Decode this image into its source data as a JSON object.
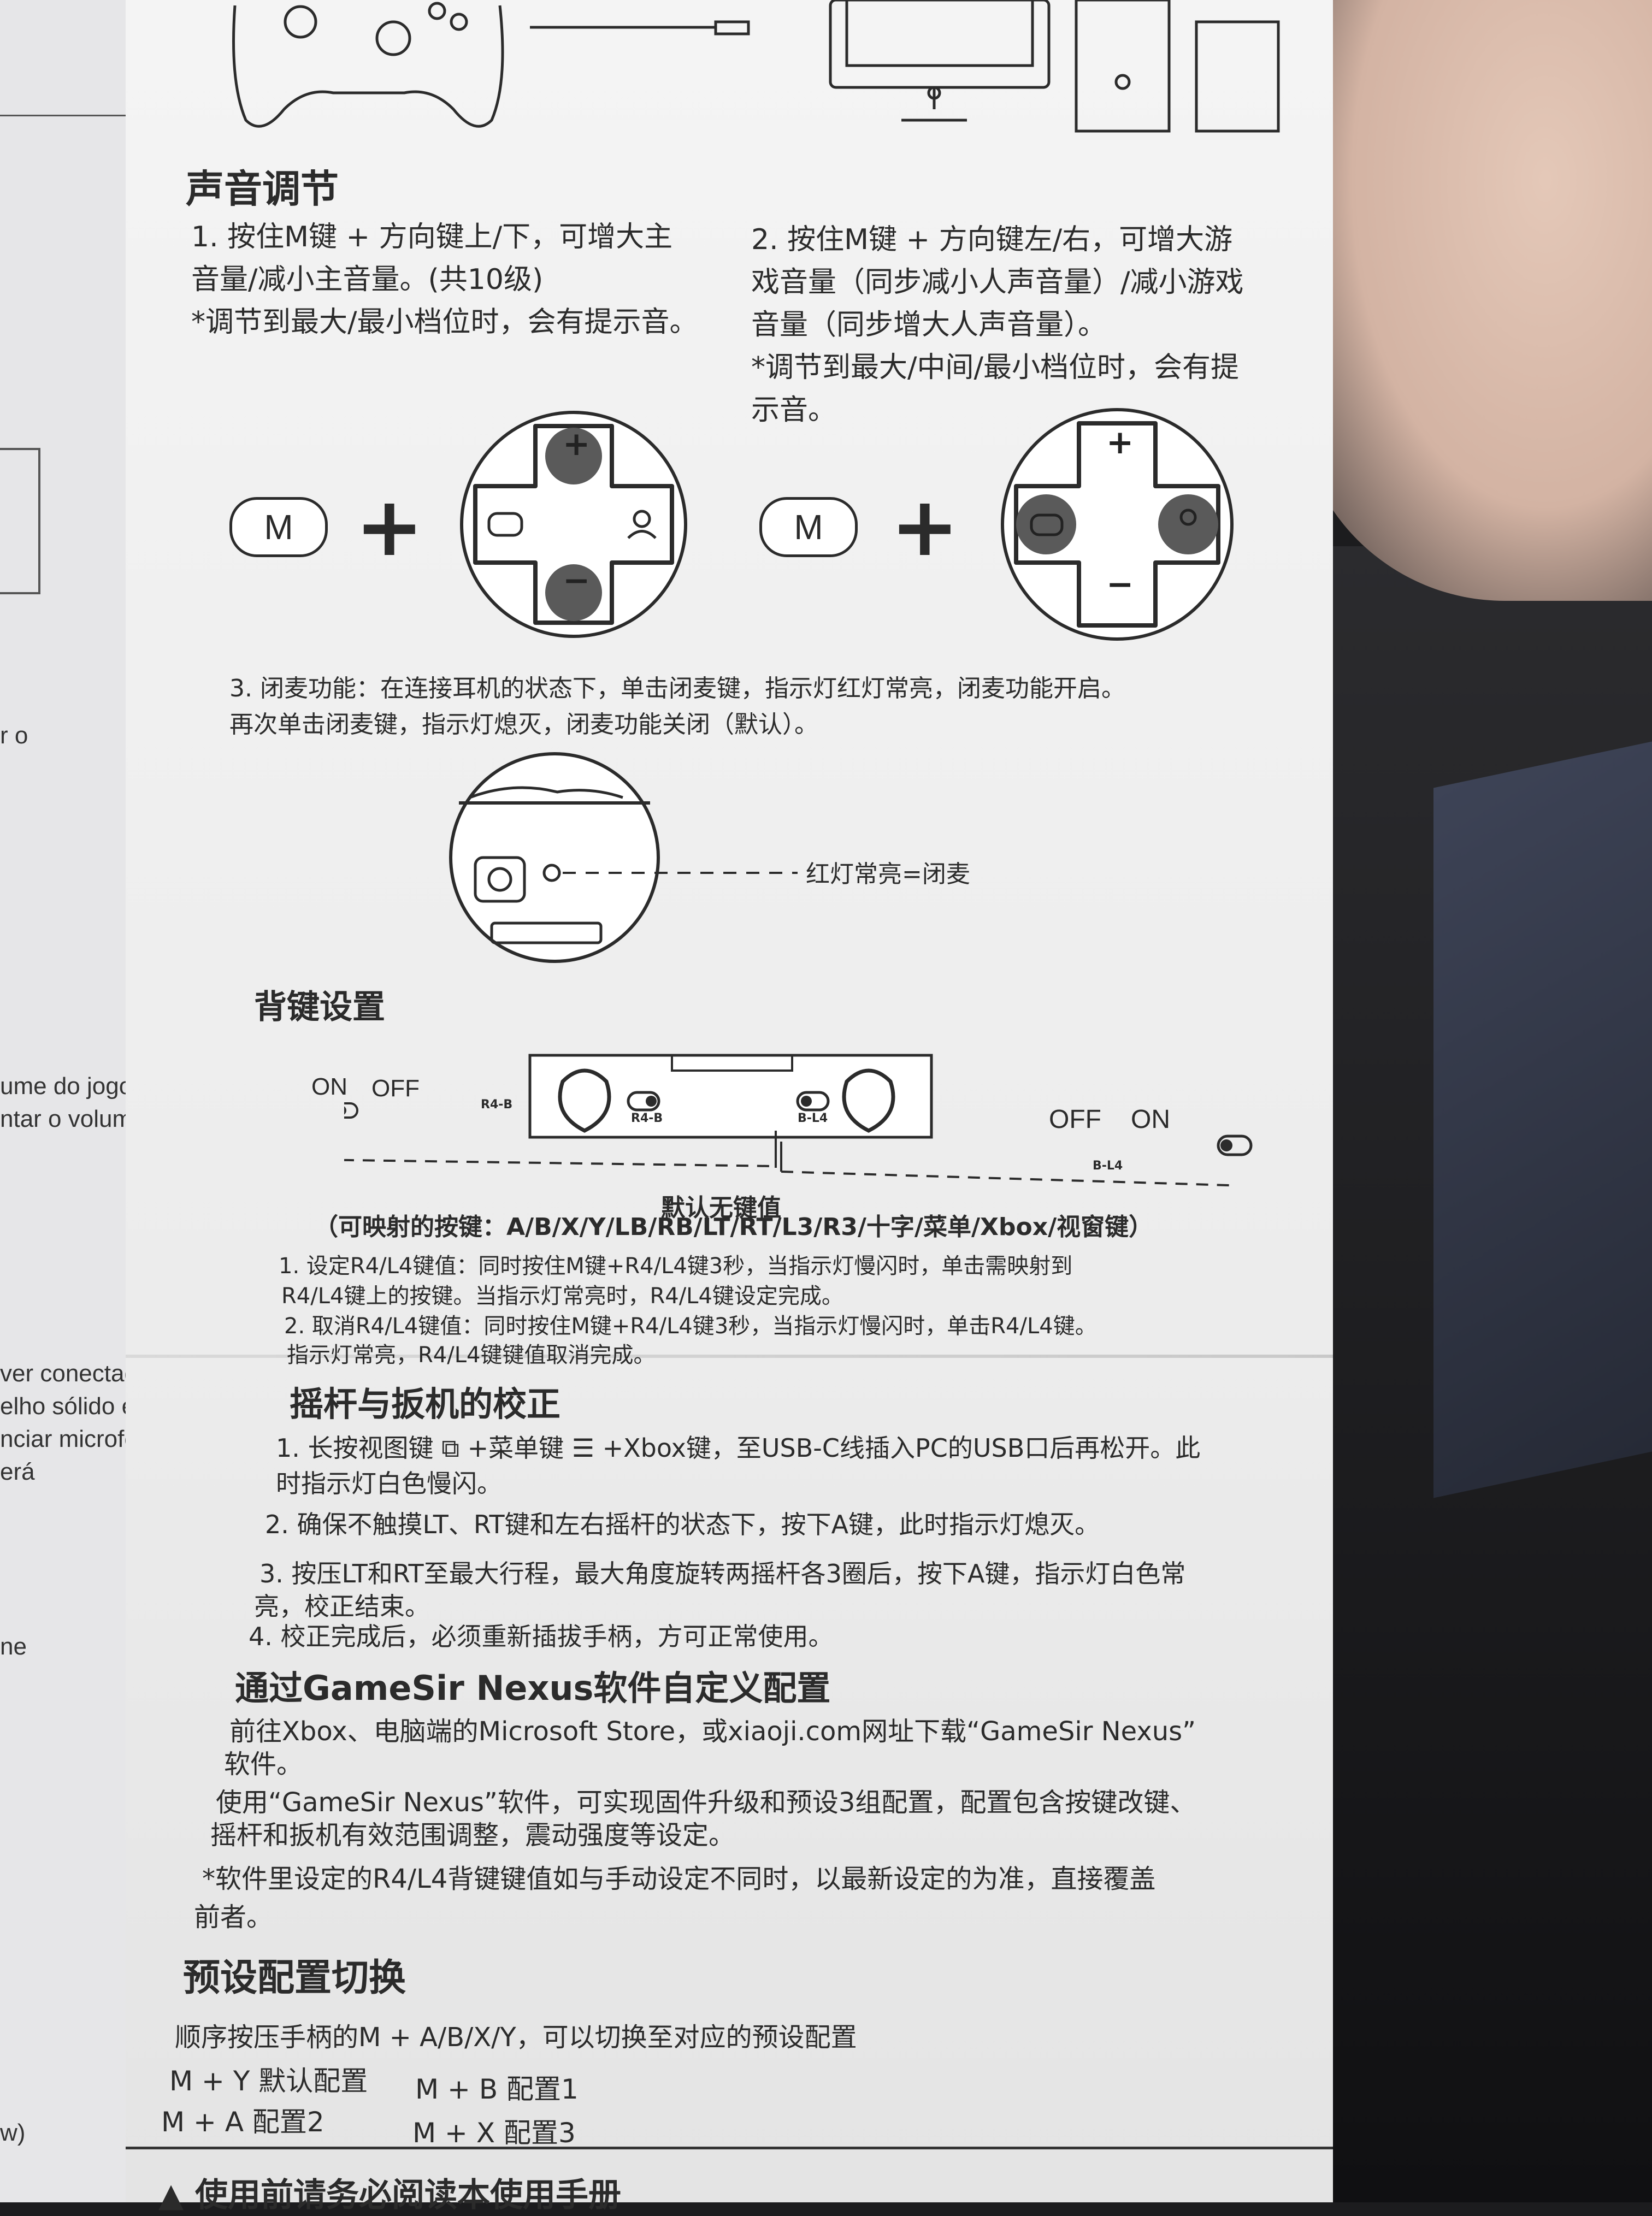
{
  "left_fragments": [
    "r o",
    "ume do jogo",
    "ntar o volume",
    "ver conectado,",
    "elho sólido e a",
    "nciar microfone",
    "erá",
    "ne",
    "w)"
  ],
  "volume": {
    "title": "声音调节",
    "item1": [
      "1. 按住M键 + 方向键上/下，可增大主",
      "音量/减小主音量。(共10级)",
      "*调节到最大/最小档位时，会有提示音。"
    ],
    "item2": [
      "2. 按住M键 + 方向键左/右，可增大游",
      "戏音量（同步减小人声音量）/减小游戏",
      "音量（同步增大人声音量）。",
      "*调节到最大/中间/最小档位时，会有提",
      "示音。"
    ],
    "key_label": "M",
    "plus_sign": "+",
    "minus_sign": "−",
    "item3": [
      "3. 闭麦功能：在连接耳机的状态下，单击闭麦键，指示灯红灯常亮，闭麦功能开启。",
      "再次单击闭麦键，指示灯熄灭，闭麦功能关闭（默认）。"
    ],
    "mic_label": "红灯常亮=闭麦"
  },
  "back": {
    "title": "背键设置",
    "left_on": "ON",
    "left_off": "OFF",
    "right_off": "OFF",
    "right_on": "ON",
    "sw_r4": "R4-B",
    "sw_l4": "B-L4",
    "default": "默认无键值",
    "mappable": "（可映射的按键：A/B/X/Y/LB/RB/LT/RT/L3/R3/十字/菜单/Xbox/视窗键）",
    "steps": [
      "1. 设定R4/L4键值：同时按住M键+R4/L4键3秒，当指示灯慢闪时，单击需映射到",
      "R4/L4键上的按键。当指示灯常亮时，R4/L4键设定完成。",
      "2. 取消R4/L4键值：同时按住M键+R4/L4键3秒，当指示灯慢闪时，单击R4/L4键。",
      "指示灯常亮，R4/L4键键值取消完成。"
    ]
  },
  "calib": {
    "title": "摇杆与扳机的校正",
    "steps": [
      "1.  长按视图键 ⧉ +菜单键 ☰ +Xbox键，至USB-C线插入PC的USB口后再松开。此",
      "时指示灯白色慢闪。",
      "2.  确保不触摸LT、RT键和左右摇杆的状态下，按下A键，此时指示灯熄灭。",
      "3.  按压LT和RT至最大行程，最大角度旋转两摇杆各3圈后，按下A键，指示灯白色常",
      "亮，校正结束。",
      "4.  校正完成后，必须重新插拔手柄，方可正常使用。"
    ]
  },
  "nexus": {
    "title": "通过GameSir Nexus软件自定义配置",
    "lines": [
      "前往Xbox、电脑端的Microsoft Store，或xiaoji.com网址下载“GameSir Nexus”",
      "软件。",
      "使用“GameSir Nexus”软件，可实现固件升级和预设3组配置，配置包含按键改键、",
      "摇杆和扳机有效范围调整，震动强度等设定。",
      "*软件里设定的R4/L4背键键值如与手动设定不同时，以最新设定的为准，直接覆盖",
      "前者。"
    ]
  },
  "preset": {
    "title": "预设配置切换",
    "intro": "顺序按压手柄的M + A/B/X/Y，可以切换至对应的预设配置",
    "c1": "M + Y  默认配置",
    "c2": "M + B  配置1",
    "c3": "M + A  配置2",
    "c4": "M + X  配置3"
  },
  "cut_off": "▲ 使用前请务必阅读本使用手册"
}
